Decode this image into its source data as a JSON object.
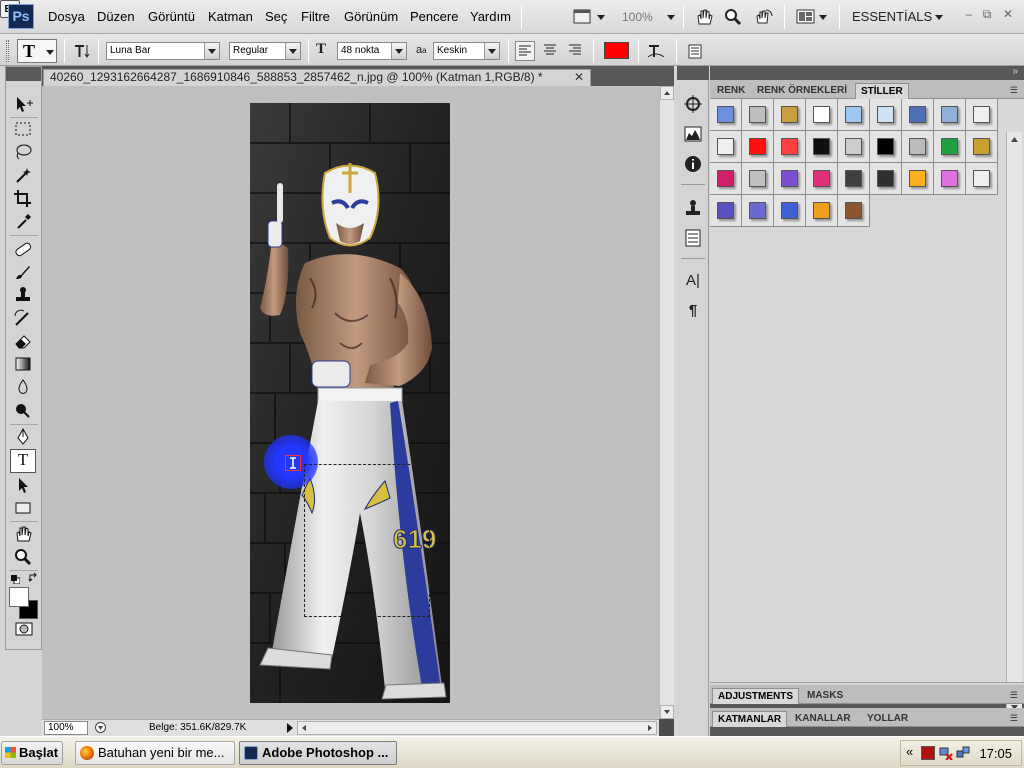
{
  "app": {
    "logo": "Ps"
  },
  "menu": [
    "Dosya",
    "Düzen",
    "Görüntü",
    "Katman",
    "Seç",
    "Filtre",
    "Görünüm",
    "Pencere",
    "Yardım"
  ],
  "menubar": {
    "bridge_label": "Br",
    "zoom": "100%",
    "workspace": "ESSENTİALS"
  },
  "options": {
    "tool_glyph": "T",
    "font_family": "Luna Bar",
    "font_style": "Regular",
    "font_size": "48 nokta",
    "antialias": "Keskin",
    "aa_glyph": "a",
    "color": "#ff0000"
  },
  "document": {
    "tab_title": "40260_1293162664287_1686910846_588853_2857462_n.jpg @ 100% (Katman 1,RGB/8) *",
    "zoom": "100%",
    "info": "Belge: 351.6K/829.7K",
    "jersey_number": "619"
  },
  "panels": {
    "top_tabs": [
      "RENK",
      "RENK ÖRNEKLERİ",
      "STİLLER"
    ],
    "middle_tabs": [
      "ADJUSTMENTS",
      "MASKS"
    ],
    "bottom_tabs": [
      "KATMANLAR",
      "KANALLAR",
      "YOLLAR"
    ]
  },
  "styles_swatches": [
    "#6e8fe0",
    "#bdbdbd",
    "#c8a040",
    "#ffffff",
    "#9ec6ee",
    "#cfe2f4",
    "#4f6fb8",
    "#8fb0d8",
    "#eeeeee",
    "#eeeeee",
    "#ff1010",
    "#ff4040",
    "#101010",
    "#cccccc",
    "#000000",
    "#bbbbbb",
    "#20a040",
    "#c8a030",
    "#d0206a",
    "#c0c0c0",
    "#7a4fd0",
    "#e0307a",
    "#404040",
    "#303030",
    "#ffb020",
    "#e070e0",
    "#eeeeee",
    "#5a50c0",
    "#6a6ad0",
    "#4060d8",
    "#f0a020",
    "#8a5530"
  ],
  "taskbar": {
    "start": "Başlat",
    "tasks": [
      "Batuhan yeni bir me...",
      "Adobe Photoshop ..."
    ],
    "clock": "17:05",
    "tray_arrow": "«"
  }
}
